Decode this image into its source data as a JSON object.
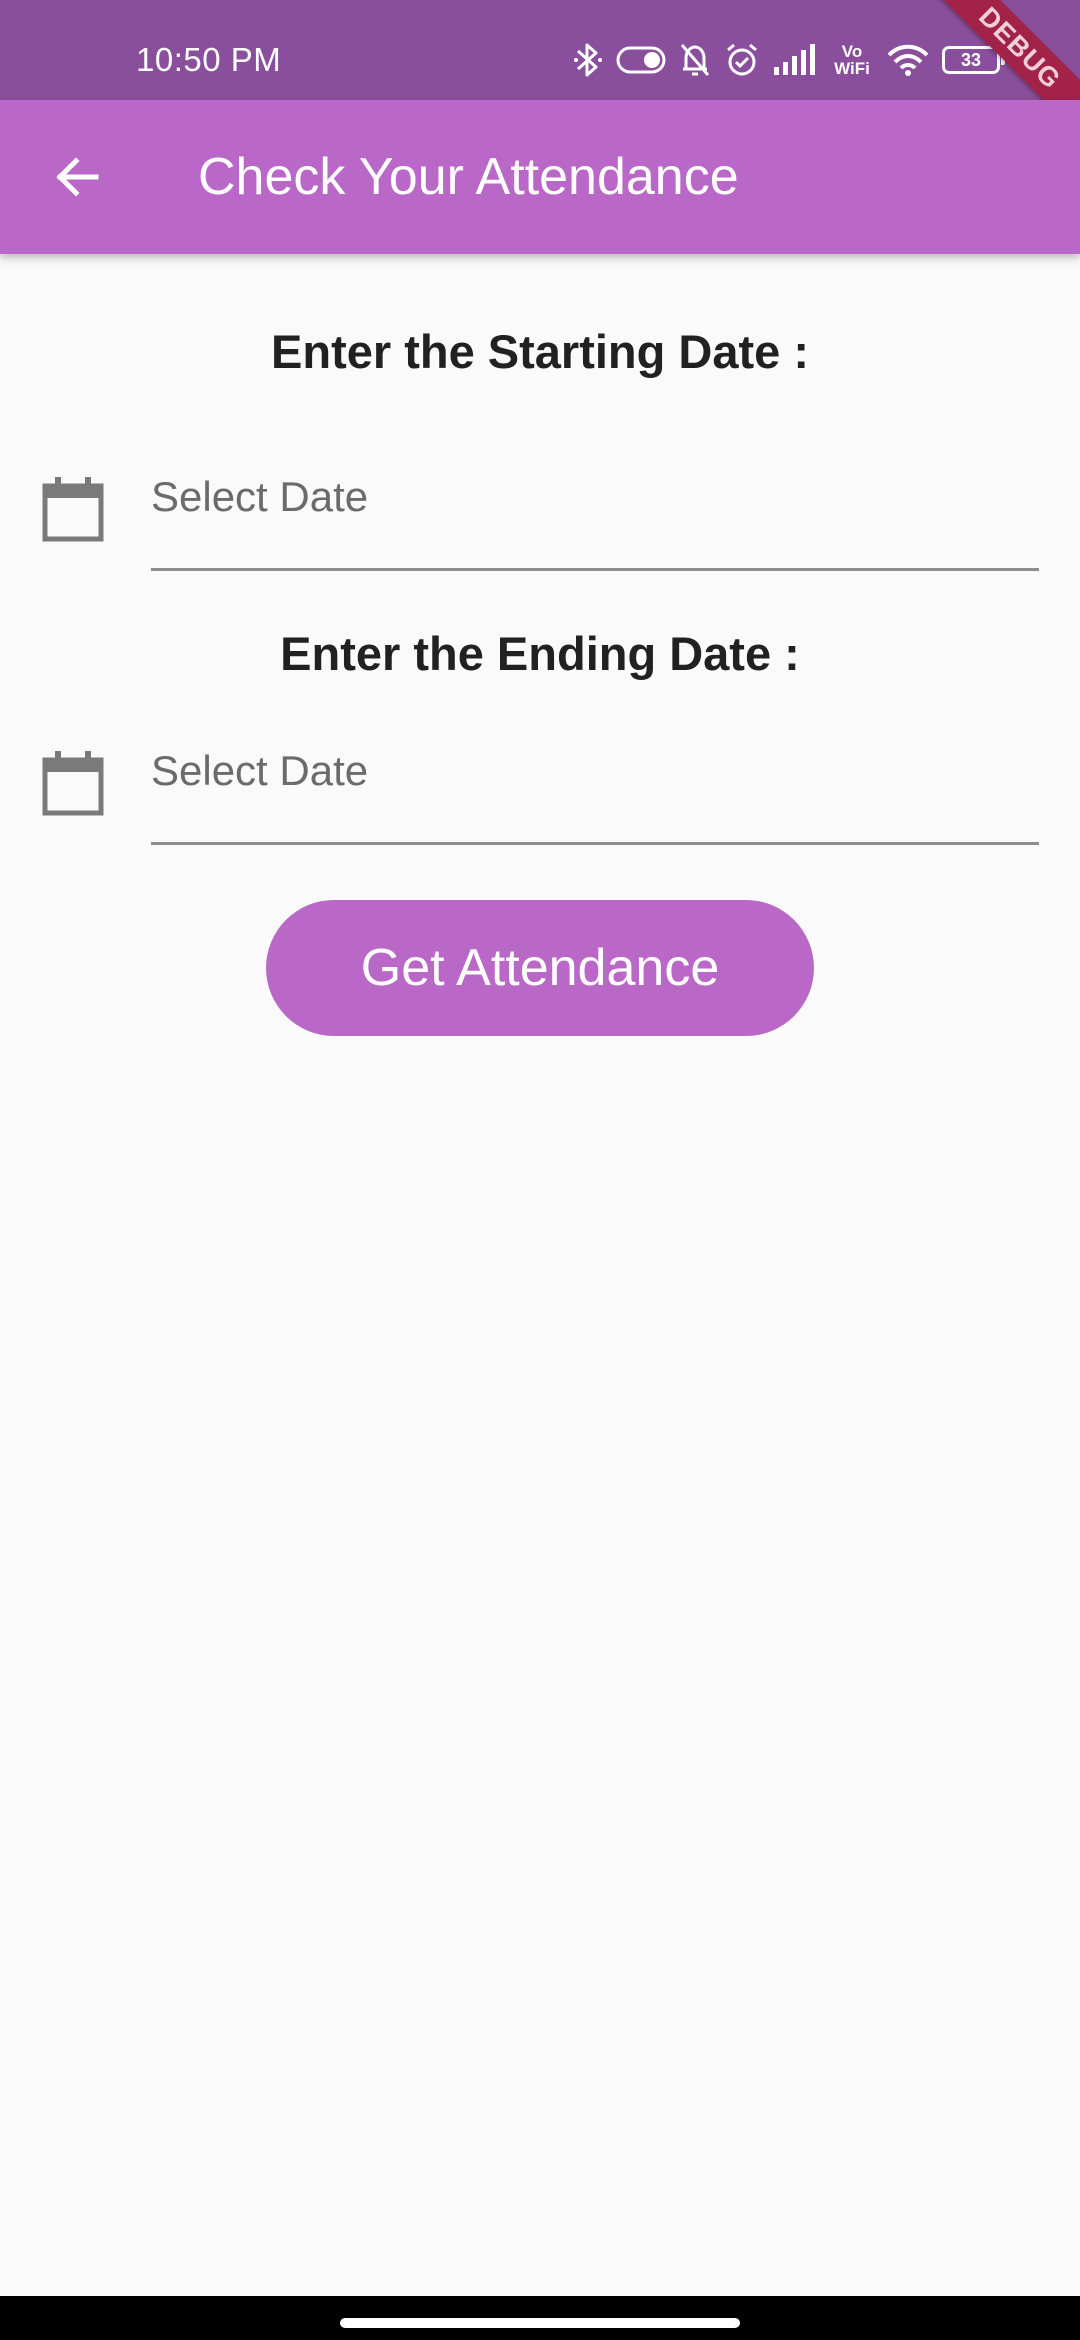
{
  "status_bar": {
    "time": "10:50 PM",
    "vowifi_top": "Vo",
    "vowifi_bottom": "WiFi",
    "battery_level": "33",
    "icons": [
      "bluetooth-icon",
      "toggle-icon",
      "bell-off-icon",
      "alarm-icon",
      "signal-icon",
      "vowifi-icon",
      "wifi-icon",
      "battery-icon"
    ],
    "background": "#8a4f9c"
  },
  "debug_banner": "DEBUG",
  "app_bar": {
    "title": "Check Your Attendance",
    "back_icon": "arrow-back-icon",
    "background": "#b968c7"
  },
  "form": {
    "start_label": "Enter the Starting Date :",
    "start_placeholder": "Select Date",
    "end_label": "Enter the Ending Date :",
    "end_placeholder": "Select Date",
    "field_icon": "calendar-icon",
    "submit_label": "Get Attendance",
    "accent": "#b968c7"
  }
}
